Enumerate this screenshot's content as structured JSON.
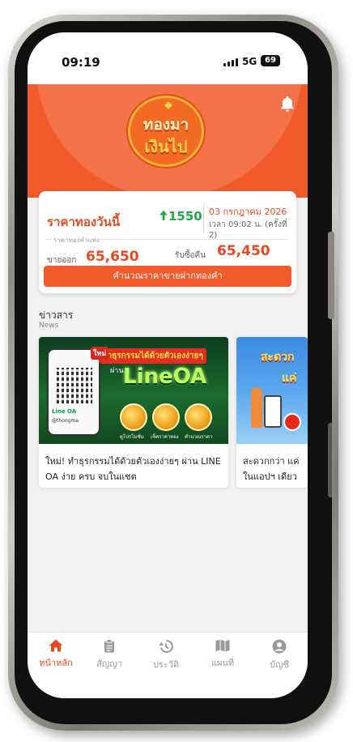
{
  "status_bar": {
    "time": "09:19",
    "network": "5G",
    "battery": "69"
  },
  "header": {
    "logo_line1": "ทองมา",
    "logo_line2": "เงินไป",
    "bell_icon": "bell-icon"
  },
  "price_card": {
    "title": "ราคาทองวันนี้",
    "change": "1550",
    "change_icon": "arrow-up-icon",
    "date": "03 กรกฎาคม 2026",
    "time_info": "เวลา 09:02 น. (ครั้งที่ 2)",
    "sublabel": "ราคาทองคำแท่ง",
    "sell_label": "ขายออก",
    "sell_value": "65,650",
    "buy_label": "รับซื้อคืน",
    "buy_value": "65,450",
    "calc_button": "คำนวณราคาขายฝากทองคำ"
  },
  "news": {
    "title": "ข่าวสาร",
    "subtitle": "News",
    "items": [
      {
        "tag": "ใหม่",
        "banner": "ทำธุรกรรมได้ด้วยตัวเองง่ายๆ",
        "via": "ผ่าน",
        "brand": "LineOA",
        "phone_badge": "Line OA",
        "phone_handle": "@thongma",
        "coin_labels": [
          "ดูโปรโมชั่น",
          "เช็คราคาทอง",
          "คำนวณราคา"
        ],
        "text": "ใหม่! ทำธุรกรรมได้ด้วยตัวเองง่ายๆ ผ่าน LINE OA ง่าย ครบ จบในแชต"
      },
      {
        "headline1": "สะดวก",
        "headline2": "แค่",
        "text": "สะดวกกว่า แค่",
        "text2": "ในแอปฯ เดียว"
      }
    ]
  },
  "bottom_nav": {
    "items": [
      {
        "label": "หน้าหลัก",
        "icon": "home-icon",
        "active": true
      },
      {
        "label": "สัญญา",
        "icon": "clipboard-icon",
        "active": false
      },
      {
        "label": "ประวัติ",
        "icon": "history-icon",
        "active": false
      },
      {
        "label": "แผนที่",
        "icon": "map-icon",
        "active": false
      },
      {
        "label": "บัญชี",
        "icon": "account-icon",
        "active": false
      }
    ]
  },
  "colors": {
    "brand_orange": "#f15a2b",
    "accent_red": "#e8481e",
    "positive_green": "#1ea84a"
  }
}
